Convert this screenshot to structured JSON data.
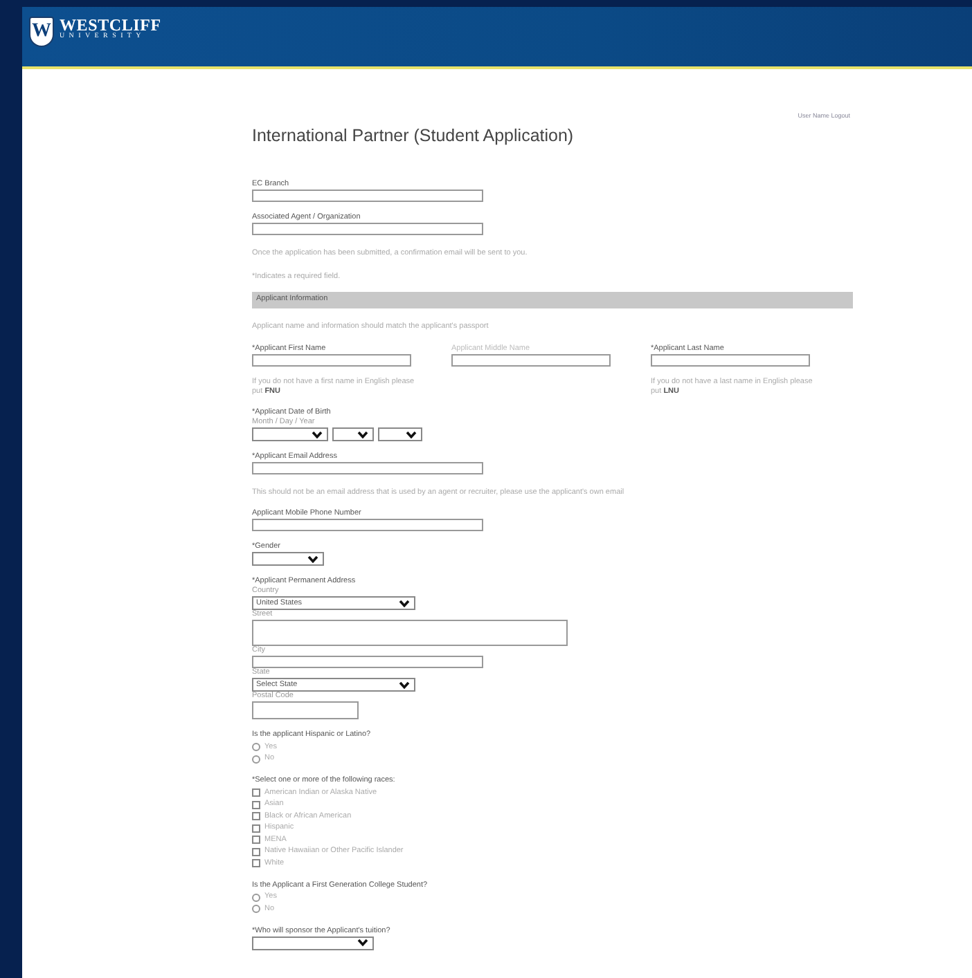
{
  "header": {
    "logo_letter": "W",
    "brand": "WESTCLIFF",
    "brand_sub": "UNIVERSITY"
  },
  "user_links": "User Name Logout",
  "form": {
    "title": "International Partner (Student Application)",
    "items": [
      {
        "kind": "label",
        "text": "EC Branch"
      },
      {
        "kind": "field"
      },
      {
        "kind": "label",
        "text": "Associated Agent / Organization"
      },
      {
        "kind": "field"
      },
      {
        "kind": "note",
        "text": "Once the application has been submitted, a confirmation email will be sent to you."
      },
      {
        "kind": "note",
        "text": "*Indicates a required field."
      },
      {
        "kind": "section",
        "text": "Applicant Information"
      },
      {
        "kind": "note",
        "text": "Applicant name and information should match the applicant's passport"
      },
      {
        "kind": "names",
        "columns": [
          {
            "label": "*Applicant First Name",
            "note": "If you do not have a first name in English please put **FNU**",
            "dim": false
          },
          {
            "label": "Applicant Middle Name",
            "dim": true
          },
          {
            "label": "*Applicant Last Name",
            "note": "If you do not have a last name in English please put **LNU**",
            "dim": false
          }
        ]
      },
      {
        "kind": "label",
        "text": "*Applicant Date of Birth"
      },
      {
        "kind": "sublabel",
        "text": "Month / Day / Year"
      },
      {
        "kind": "date"
      },
      {
        "kind": "label",
        "text": "*Applicant Email Address"
      },
      {
        "kind": "field"
      },
      {
        "kind": "note",
        "text": "This should not be an email address that is used by an agent or recruiter, please use the applicant's own email"
      },
      {
        "kind": "label",
        "text": "Applicant Mobile Phone Number"
      },
      {
        "kind": "field"
      },
      {
        "kind": "label",
        "text": "*Gender"
      },
      {
        "kind": "select"
      },
      {
        "kind": "label",
        "text": "*Applicant Permanent Address"
      },
      {
        "kind": "sublabel",
        "text": "Country"
      },
      {
        "kind": "long-select",
        "value": "United States"
      },
      {
        "kind": "sublabel",
        "text": "Street"
      },
      {
        "kind": "textarea"
      },
      {
        "kind": "sublabel",
        "text": "City"
      },
      {
        "kind": "field"
      },
      {
        "kind": "sublabel",
        "text": "State"
      },
      {
        "kind": "long-select",
        "value": "Select State"
      },
      {
        "kind": "sublabel",
        "text": "Postal Code"
      },
      {
        "kind": "short-field"
      },
      {
        "kind": "label",
        "text": "Is the applicant Hispanic or Latino?"
      },
      {
        "kind": "radios",
        "options": [
          {
            "label": "Yes",
            "checked": false
          },
          {
            "label": "No",
            "checked": false
          }
        ]
      },
      {
        "kind": "label",
        "text": "*Select one or more of the following races:"
      },
      {
        "kind": "checkboxes",
        "options": [
          {
            "label": "American Indian or Alaska Native",
            "checked": false
          },
          {
            "label": "Asian",
            "checked": false
          },
          {
            "label": "Black or African American",
            "checked": false
          },
          {
            "label": "Hispanic",
            "checked": false
          },
          {
            "label": "MENA",
            "checked": false
          },
          {
            "label": "Native Hawaiian or Other Pacific Islander",
            "checked": false
          },
          {
            "label": "White",
            "checked": false
          }
        ]
      },
      {
        "kind": "label",
        "text": "Is the Applicant a First Generation College Student?"
      },
      {
        "kind": "radios",
        "options": [
          {
            "label": "Yes",
            "checked": false
          },
          {
            "label": "No",
            "checked": false
          }
        ]
      },
      {
        "kind": "label",
        "text": "*Who will sponsor the Applicant's tuition?"
      },
      {
        "kind": "mid-select"
      }
    ]
  }
}
